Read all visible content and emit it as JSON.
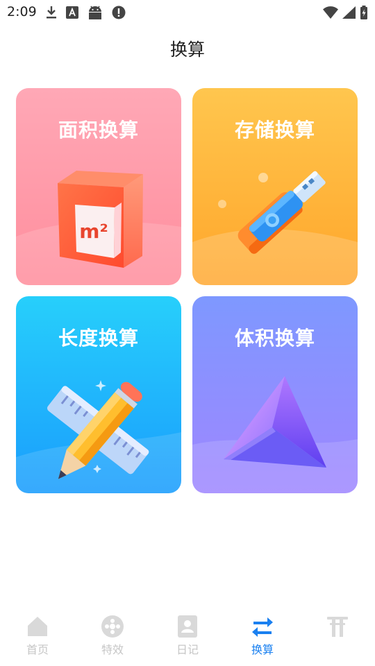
{
  "status_bar": {
    "time": "2:09",
    "left_icons": [
      "download-icon",
      "font-a-icon",
      "android-icon",
      "alert-icon"
    ],
    "right_icons": [
      "wifi-icon",
      "signal-icon",
      "battery-charging-icon"
    ]
  },
  "page": {
    "title": "换算"
  },
  "cards": [
    {
      "id": "area",
      "title": "面积换算",
      "icon": "area-m2-block-icon",
      "icon_text": "m²",
      "color": "#ff9aa8"
    },
    {
      "id": "storage",
      "title": "存储换算",
      "icon": "usb-drive-icon",
      "color": "#ffb63c"
    },
    {
      "id": "length",
      "title": "长度换算",
      "icon": "pencil-ruler-icon",
      "color": "#22b8fc"
    },
    {
      "id": "volume",
      "title": "体积换算",
      "icon": "pyramid-icon",
      "color": "#8f90ff"
    }
  ],
  "bottom_nav": {
    "active": "换算",
    "active_color": "#1a80f0",
    "inactive_color": "#c6c6c6",
    "items": [
      {
        "label": "首页",
        "icon": "home-icon"
      },
      {
        "label": "特效",
        "icon": "effects-icon"
      },
      {
        "label": "日记",
        "icon": "diary-icon"
      },
      {
        "label": "换算",
        "icon": "convert-arrows-icon"
      },
      {
        "label": "",
        "icon": "gate-icon"
      }
    ]
  }
}
